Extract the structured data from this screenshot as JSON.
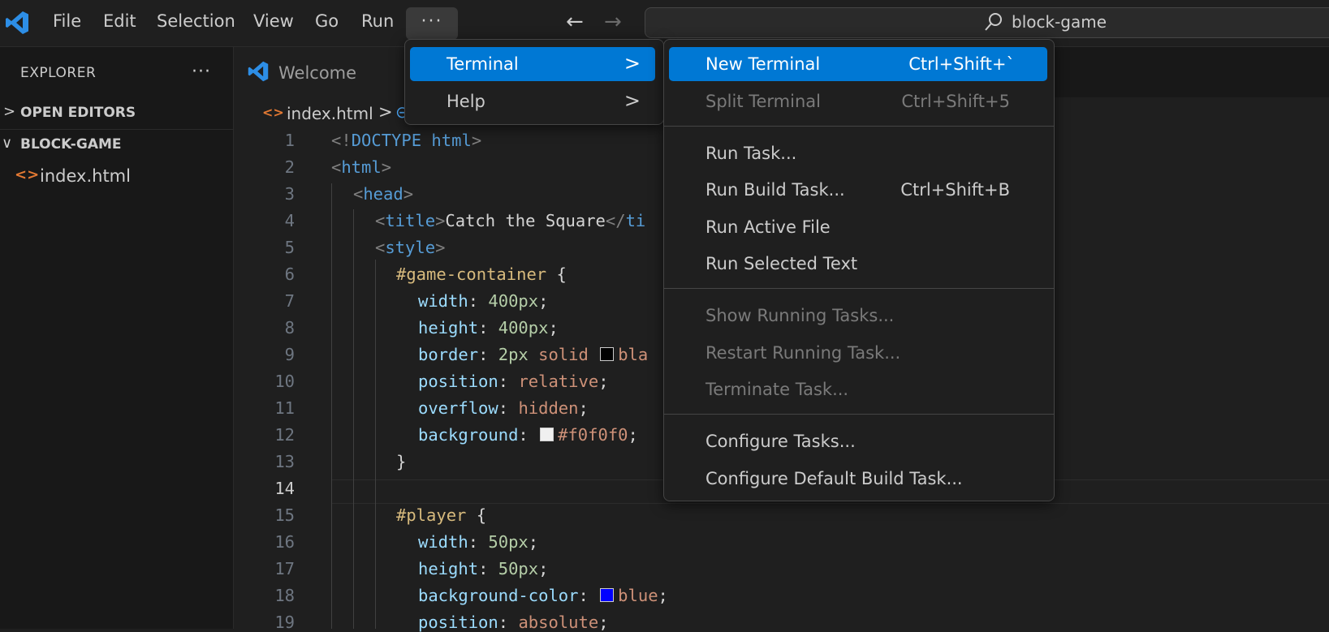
{
  "menubar": {
    "items": [
      "File",
      "Edit",
      "Selection",
      "View",
      "Go",
      "Run"
    ],
    "more_label": "···"
  },
  "nav": {
    "back": "←",
    "forward": "→"
  },
  "search": {
    "text": "block-game"
  },
  "sidebar": {
    "title": "EXPLORER",
    "more": "···",
    "sections": [
      {
        "label": "OPEN EDITORS",
        "chevron": ">"
      },
      {
        "label": "BLOCK-GAME",
        "chevron": "∨"
      }
    ],
    "file": {
      "name": "index.html",
      "icon": "<>"
    }
  },
  "tabs": [
    {
      "label": "Welcome"
    }
  ],
  "breadcrumb": {
    "icon": "<>",
    "file": "index.html",
    "sep": ">",
    "symbol": "⊝"
  },
  "editor": {
    "line_numbers": [
      "1",
      "2",
      "3",
      "4",
      "5",
      "6",
      "7",
      "8",
      "9",
      "10",
      "11",
      "12",
      "13",
      "14",
      "15",
      "16",
      "17",
      "18",
      "19"
    ],
    "active_line": "14",
    "swatch_colors": {
      "black": "#000000",
      "f0": "#f0f0f0",
      "blue": "#0000ff"
    }
  },
  "more_menu": {
    "items": [
      {
        "label": "Terminal",
        "arrow": ">",
        "selected": true
      },
      {
        "label": "Help",
        "arrow": ">",
        "selected": false
      }
    ]
  },
  "terminal_menu": {
    "groups": [
      [
        {
          "label": "New Terminal",
          "shortcut": "Ctrl+Shift+`",
          "selected": true,
          "disabled": false
        },
        {
          "label": "Split Terminal",
          "shortcut": "Ctrl+Shift+5",
          "selected": false,
          "disabled": true
        }
      ],
      [
        {
          "label": "Run Task...",
          "shortcut": "",
          "disabled": false
        },
        {
          "label": "Run Build Task...",
          "shortcut": "Ctrl+Shift+B",
          "disabled": false
        },
        {
          "label": "Run Active File",
          "shortcut": "",
          "disabled": false
        },
        {
          "label": "Run Selected Text",
          "shortcut": "",
          "disabled": false
        }
      ],
      [
        {
          "label": "Show Running Tasks...",
          "shortcut": "",
          "disabled": true
        },
        {
          "label": "Restart Running Task...",
          "shortcut": "",
          "disabled": true
        },
        {
          "label": "Terminate Task...",
          "shortcut": "",
          "disabled": true
        }
      ],
      [
        {
          "label": "Configure Tasks...",
          "shortcut": "",
          "disabled": false
        },
        {
          "label": "Configure Default Build Task...",
          "shortcut": "",
          "disabled": false
        }
      ]
    ]
  },
  "code": {
    "l1": {
      "open": "<!",
      "kw": "DOCTYPE",
      "rest": " html",
      "close": ">"
    },
    "l2": {
      "open": "<",
      "tag": "html",
      "close": ">"
    },
    "l3": {
      "open": "<",
      "tag": "head",
      "close": ">"
    },
    "l4": {
      "open": "<",
      "tag": "title",
      "close": ">",
      "text": "Catch the Square",
      "endopen": "</",
      "endtag": "ti"
    },
    "l5": {
      "open": "<",
      "tag": "style",
      "close": ">"
    },
    "l6": {
      "sel": "#game-container",
      "brace": " {"
    },
    "l7": {
      "prop": "width",
      "colon": ": ",
      "num": "400px",
      "semi": ";"
    },
    "l8": {
      "prop": "height",
      "colon": ": ",
      "num": "400px",
      "semi": ";"
    },
    "l9": {
      "prop": "border",
      "colon": ": ",
      "num": "2px",
      "val": " solid ",
      "val2": "bla"
    },
    "l10": {
      "prop": "position",
      "colon": ": ",
      "val": "relative",
      "semi": ";"
    },
    "l11": {
      "prop": "overflow",
      "colon": ": ",
      "val": "hidden",
      "semi": ";"
    },
    "l12": {
      "prop": "background",
      "colon": ": ",
      "val": "#f0f0f0",
      "semi": ";"
    },
    "l13": {
      "brace": "}"
    },
    "l15": {
      "sel": "#player",
      "brace": " {"
    },
    "l16": {
      "prop": "width",
      "colon": ": ",
      "num": "50px",
      "semi": ";"
    },
    "l17": {
      "prop": "height",
      "colon": ": ",
      "num": "50px",
      "semi": ";"
    },
    "l18": {
      "prop": "background-color",
      "colon": ": ",
      "val": "blue",
      "semi": ";"
    },
    "l19": {
      "prop": "position",
      "colon": ": ",
      "val": "absolute",
      "semi": ";"
    }
  }
}
